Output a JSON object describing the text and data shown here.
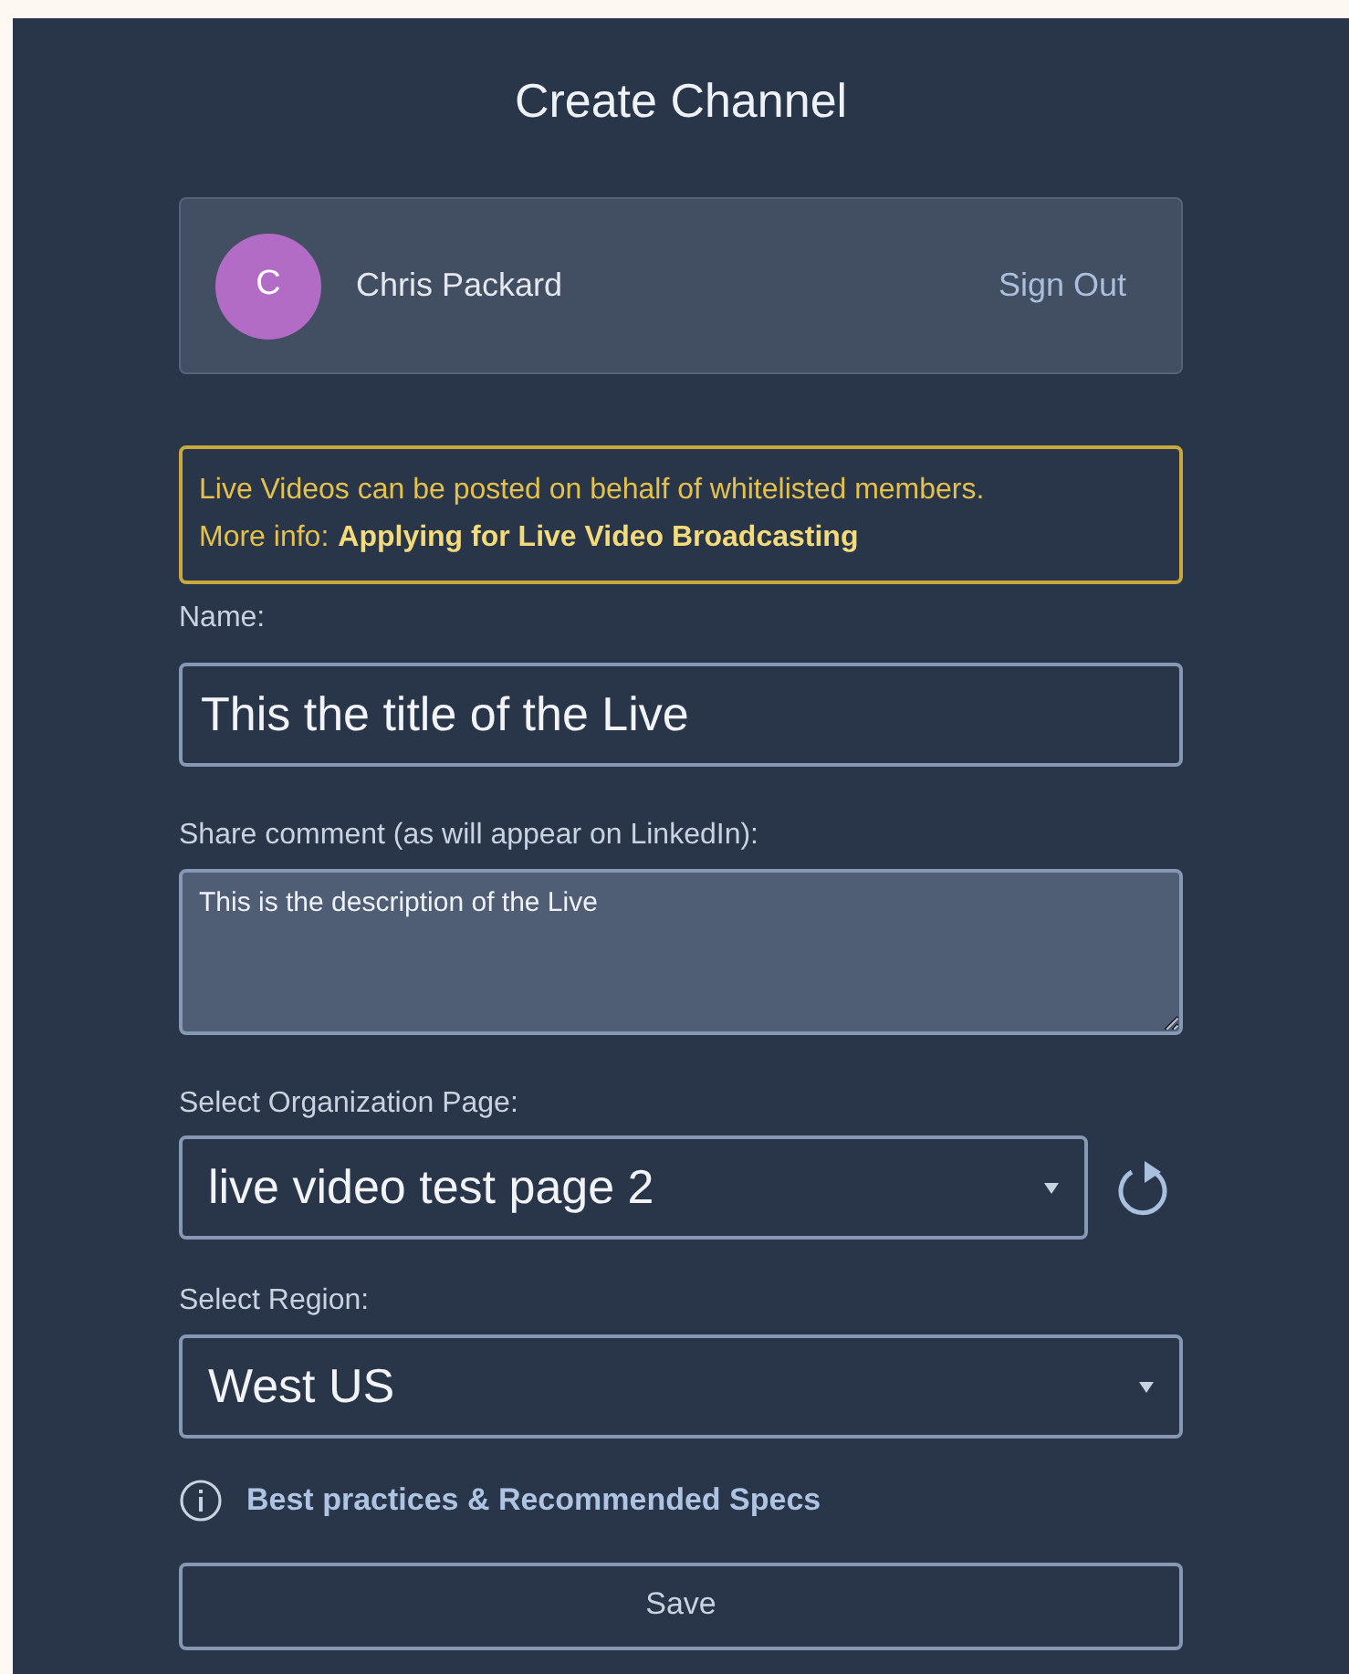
{
  "dialog": {
    "title": "Create Channel",
    "account": {
      "initial": "C",
      "name": "Chris Packard",
      "sign_out": "Sign Out"
    },
    "notice": {
      "text": "Live Videos can be posted on behalf of whitelisted members.",
      "more_label": "More info:",
      "link": "Applying for Live Video Broadcasting"
    },
    "name": {
      "label": "Name:",
      "value": "This the title of the Live"
    },
    "comment": {
      "label": "Share comment (as will appear on LinkedIn):",
      "value": "This is the description of the Live"
    },
    "organization": {
      "label": "Select Organization Page:",
      "value": "live video test page 2"
    },
    "region": {
      "label": "Select Region:",
      "value": "West US"
    },
    "specs_link": "Best practices & Recommended Specs",
    "save": "Save"
  }
}
